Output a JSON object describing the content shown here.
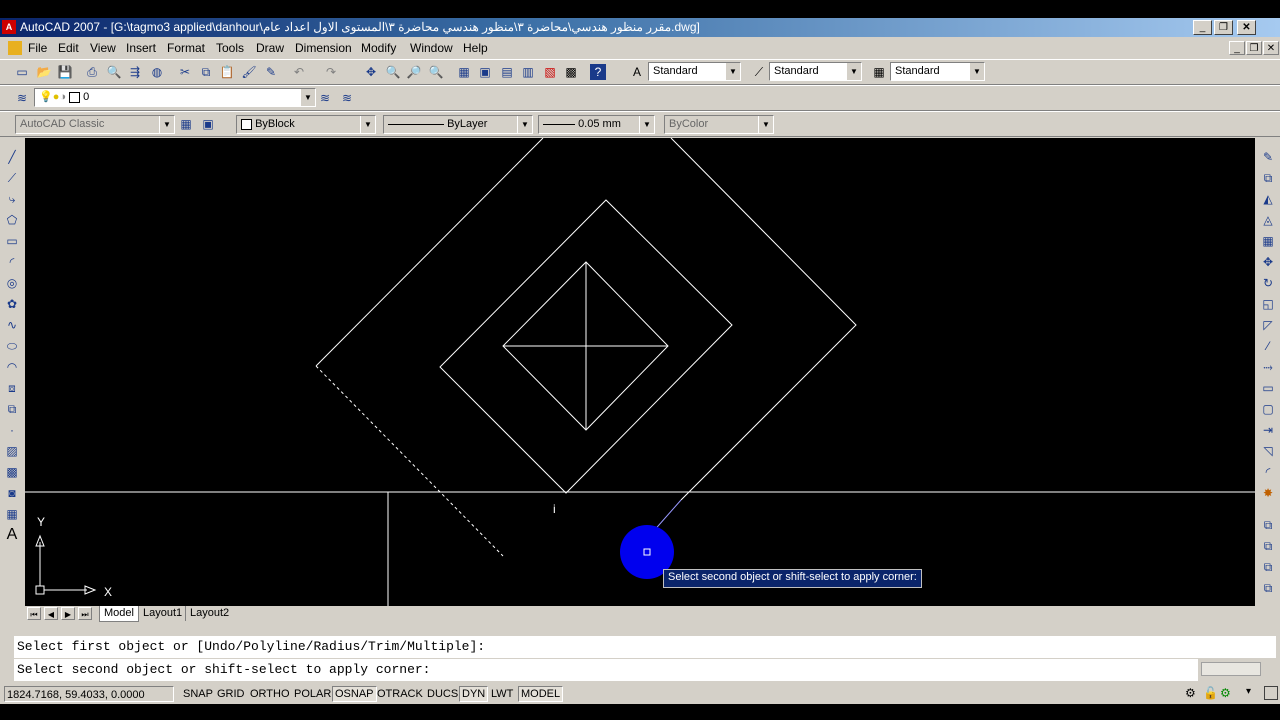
{
  "window": {
    "title": "AutoCAD 2007 - [G:\\tagmo3 applied\\danhour\\مقرر منظور هندسي\\محاضرة ٣\\منظور هندسي محاضرة ٣\\المستوى الاول اعداد عام.dwg]",
    "app_icon": "A"
  },
  "menu": [
    "File",
    "Edit",
    "View",
    "Insert",
    "Format",
    "Tools",
    "Draw",
    "Dimension",
    "Modify",
    "Window",
    "Help"
  ],
  "styles": {
    "text_style": "Standard",
    "dim_style": "Standard",
    "table_style": "Standard"
  },
  "layer": {
    "current": "0"
  },
  "workspace": "AutoCAD Classic",
  "properties": {
    "color": "ByBlock",
    "linetype": "ByLayer",
    "lineweight": "0.05 mm",
    "plotstyle": "ByColor"
  },
  "ucs": {
    "x_label": "X",
    "y_label": "Y"
  },
  "tabs": [
    "Model",
    "Layout1",
    "Layout2"
  ],
  "tooltip": "Select second object or shift-select to apply corner:",
  "cursor_label": "i",
  "command": {
    "history": "Select first object or [Undo/Polyline/Radius/Trim/Multiple]:",
    "prompt": "Select second object or shift-select to apply corner:"
  },
  "status": {
    "coords": "1824.7168, 59.4033, 0.0000",
    "toggles": [
      {
        "label": "SNAP",
        "on": false
      },
      {
        "label": "GRID",
        "on": false
      },
      {
        "label": "ORTHO",
        "on": false
      },
      {
        "label": "POLAR",
        "on": false
      },
      {
        "label": "OSNAP",
        "on": true
      },
      {
        "label": "OTRACK",
        "on": false
      },
      {
        "label": "DUCS",
        "on": false
      },
      {
        "label": "DYN",
        "on": true
      },
      {
        "label": "LWT",
        "on": false
      },
      {
        "label": "MODEL",
        "on": true
      }
    ]
  },
  "colors": {
    "canvas": "#000000",
    "highlight": "#0000ff",
    "linework": "#ffffff"
  }
}
